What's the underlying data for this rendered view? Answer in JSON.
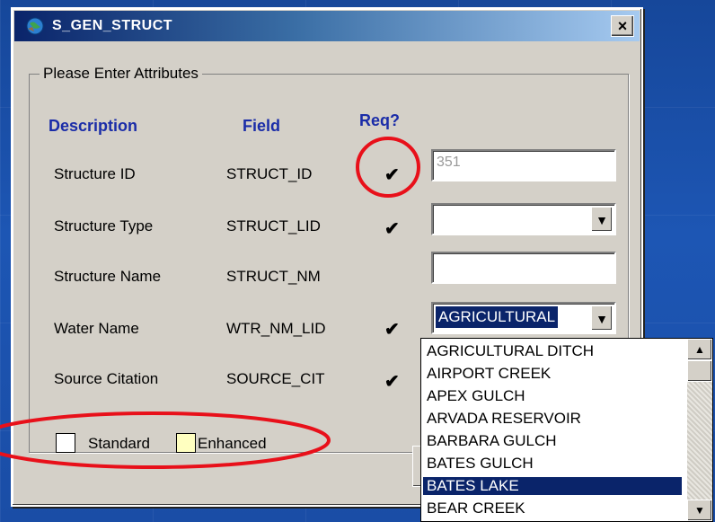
{
  "window": {
    "title": "S_GEN_STRUCT",
    "close_glyph": "×"
  },
  "group": {
    "label": "Please Enter Attributes"
  },
  "headers": {
    "description": "Description",
    "field": "Field",
    "required": "Req?"
  },
  "rows": [
    {
      "description": "Structure ID",
      "field": "STRUCT_ID",
      "required": true,
      "control": "text",
      "value": "351"
    },
    {
      "description": "Structure Type",
      "field": "STRUCT_LID",
      "required": true,
      "control": "combo",
      "value": ""
    },
    {
      "description": "Structure Name",
      "field": "STRUCT_NM",
      "required": false,
      "control": "text",
      "value": ""
    },
    {
      "description": "Water Name",
      "field": "WTR_NM_LID",
      "required": true,
      "control": "combo",
      "value": "AGRICULTURAL"
    },
    {
      "description": "Source Citation",
      "field": "SOURCE_CIT",
      "required": true,
      "control": "combo",
      "value": ""
    }
  ],
  "check_glyph": "✔",
  "legend": {
    "standard": "Standard",
    "enhanced": "Enhanced",
    "standard_color": "#ffffff",
    "enhanced_color": "#ffffc0"
  },
  "dropdown": {
    "items": [
      "AGRICULTURAL DITCH",
      "AIRPORT CREEK",
      "APEX GULCH",
      "ARVADA RESERVOIR",
      "BARBARA GULCH",
      "BATES GULCH",
      "BATES LAKE",
      "BEAR CREEK"
    ],
    "selected_index": 6
  },
  "annotations": {
    "circle_color": "#e8101a"
  }
}
